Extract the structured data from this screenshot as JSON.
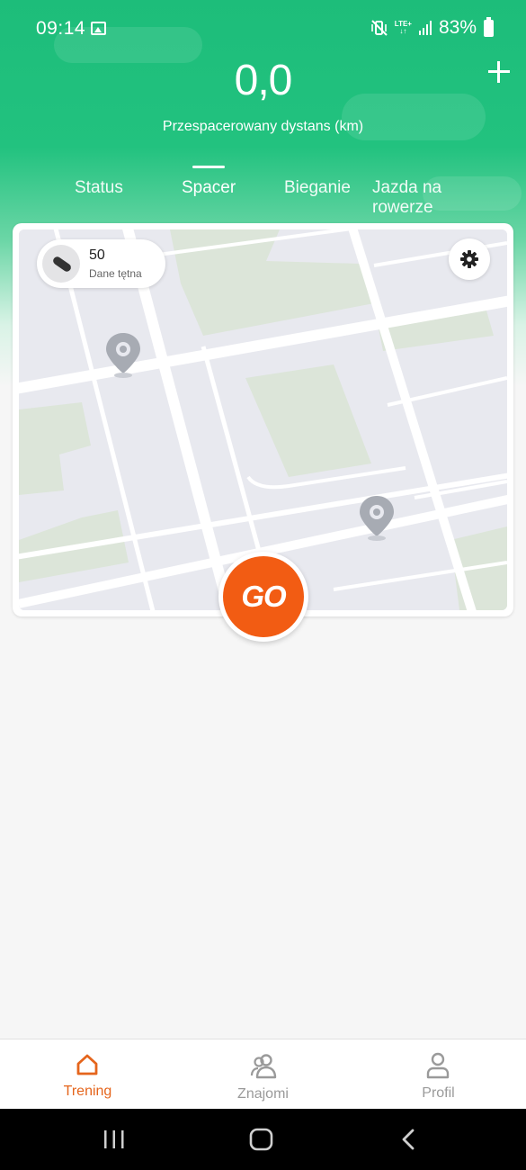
{
  "status_bar": {
    "time": "09:14",
    "network": "LTE+",
    "battery": "83%"
  },
  "header": {
    "distance": "0,0",
    "distance_label": "Przespacerowany dystans (km)",
    "tabs": [
      {
        "label": "Status",
        "active": false
      },
      {
        "label": "Spacer",
        "active": true
      },
      {
        "label": "Bieganie",
        "active": false
      },
      {
        "label": "Jazda na rowerze",
        "active": false
      }
    ]
  },
  "map_card": {
    "heart_rate_value": "50",
    "heart_rate_label": "Dane tętna",
    "go_label": "GO"
  },
  "bottom_nav": {
    "items": [
      {
        "label": "Trening",
        "icon": "home-icon",
        "active": true
      },
      {
        "label": "Znajomi",
        "icon": "friends-icon",
        "active": false
      },
      {
        "label": "Profil",
        "icon": "profile-icon",
        "active": false
      }
    ]
  },
  "colors": {
    "brand_green": "#1dbd7a",
    "go_orange": "#f25c13",
    "active_nav": "#e5651c"
  }
}
